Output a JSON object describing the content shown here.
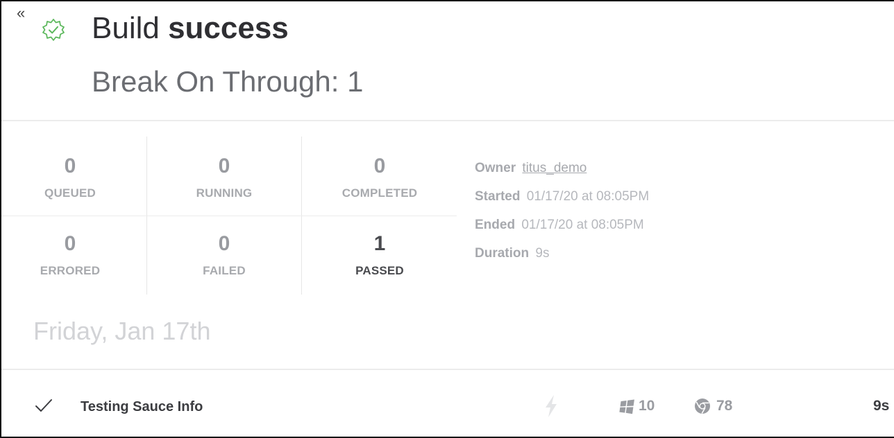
{
  "header": {
    "collapse_glyph": "«",
    "title_prefix": "Build ",
    "title_strong": "success",
    "subtitle": "Break On Through: 1",
    "status_icon": "gear-check-icon",
    "status_color": "#5cb85c"
  },
  "stats": [
    {
      "value": "0",
      "label": "QUEUED"
    },
    {
      "value": "0",
      "label": "RUNNING"
    },
    {
      "value": "0",
      "label": "COMPLETED"
    },
    {
      "value": "0",
      "label": "ERRORED"
    },
    {
      "value": "0",
      "label": "FAILED"
    },
    {
      "value": "1",
      "label": "PASSED"
    }
  ],
  "meta": {
    "owner_label": "Owner",
    "owner_value": "titus_demo",
    "started_label": "Started",
    "started_value": "01/17/20 at 08:05PM",
    "ended_label": "Ended",
    "ended_value": "01/17/20 at 08:05PM",
    "duration_label": "Duration",
    "duration_value": "9s"
  },
  "date_heading": "Friday, Jan 17th",
  "jobs": [
    {
      "status_icon": "checkmark-icon",
      "name": "Testing Sauce Info",
      "trigger_icon": "lightning-bolt-icon",
      "os_icon": "windows-icon",
      "os_version": "10",
      "browser_icon": "chrome-icon",
      "browser_version": "78",
      "duration": "9s"
    }
  ]
}
